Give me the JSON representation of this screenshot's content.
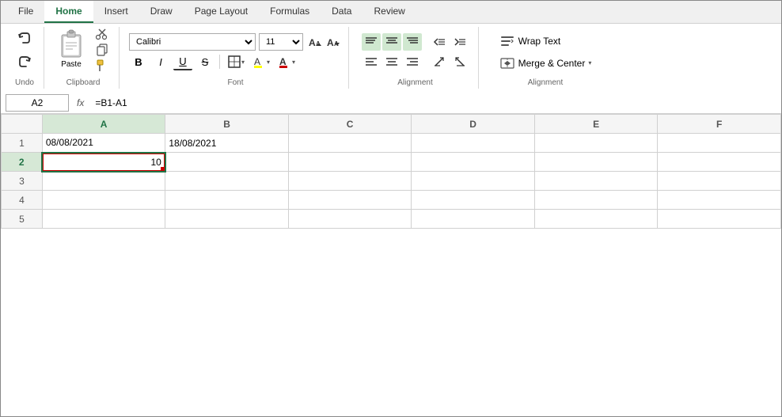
{
  "ribbon": {
    "tabs": [
      {
        "label": "File",
        "active": false
      },
      {
        "label": "Home",
        "active": true
      },
      {
        "label": "Insert",
        "active": false
      },
      {
        "label": "Draw",
        "active": false
      },
      {
        "label": "Page Layout",
        "active": false
      },
      {
        "label": "Formulas",
        "active": false
      },
      {
        "label": "Data",
        "active": false
      },
      {
        "label": "Review",
        "active": false
      }
    ],
    "groups": {
      "undo": {
        "label": "Undo",
        "undo_icon": "↩",
        "redo_icon": "↪"
      },
      "clipboard": {
        "label": "Clipboard",
        "paste_label": "Paste"
      },
      "font": {
        "label": "Font",
        "font_name": "Calibri",
        "font_size": "11",
        "bold": "B",
        "italic": "I",
        "underline": "U",
        "strikethrough": "S"
      },
      "alignment": {
        "label": "Alignment"
      },
      "wrap_merge": {
        "label": "Alignment",
        "wrap_text": "Wrap Text",
        "merge_center": "Merge & Center"
      }
    }
  },
  "formula_bar": {
    "cell_ref": "A2",
    "fx_label": "fx",
    "formula": "=B1-A1"
  },
  "spreadsheet": {
    "columns": [
      "A",
      "B",
      "C",
      "D",
      "E",
      "F"
    ],
    "rows": [
      {
        "row_num": "1",
        "cells": [
          "08/08/2021",
          "18/08/2021",
          "",
          "",
          "",
          ""
        ]
      },
      {
        "row_num": "2",
        "cells": [
          "10",
          "",
          "",
          "",
          "",
          ""
        ]
      },
      {
        "row_num": "3",
        "cells": [
          "",
          "",
          "",
          "",
          "",
          ""
        ]
      },
      {
        "row_num": "4",
        "cells": [
          "",
          "",
          "",
          "",
          "",
          ""
        ]
      },
      {
        "row_num": "5",
        "cells": [
          "",
          "",
          "",
          "",
          "",
          ""
        ]
      }
    ]
  }
}
